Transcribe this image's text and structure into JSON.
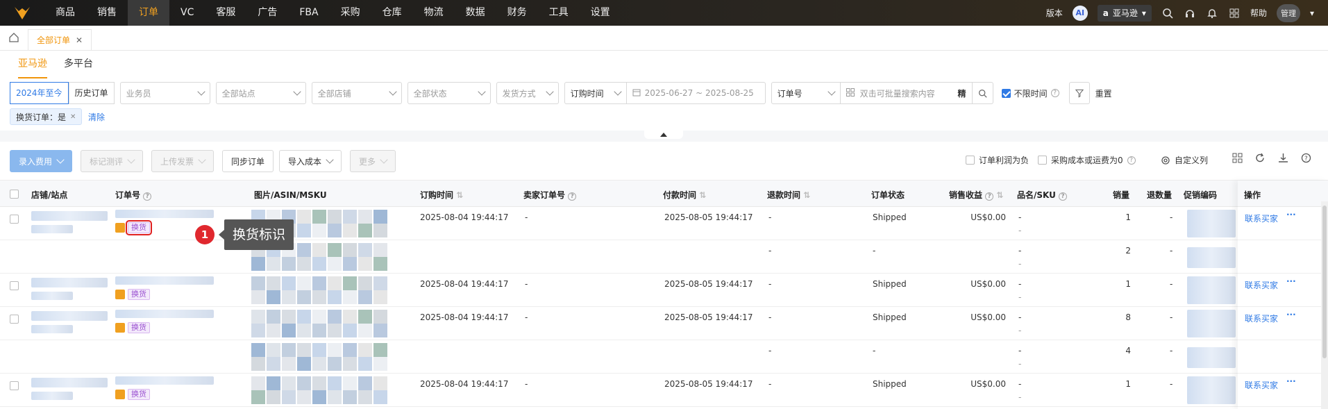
{
  "nav": {
    "items": [
      "商品",
      "销售",
      "订单",
      "VC",
      "客服",
      "广告",
      "FBA",
      "采购",
      "仓库",
      "物流",
      "数据",
      "财务",
      "工具",
      "设置"
    ],
    "active": "订单",
    "version_label": "版本",
    "ai_label": "AI",
    "marketplace": "亚马逊",
    "help_label": "帮助",
    "user_label": "管理"
  },
  "tabs": {
    "page_tab": "全部订单"
  },
  "sub_tabs": [
    "亚马逊",
    "多平台"
  ],
  "filters": {
    "period_seg": [
      "2024年至今",
      "历史订单"
    ],
    "salesperson": "业务员",
    "site": "全部站点",
    "store": "全部店铺",
    "status": "全部状态",
    "ship_method": "发货方式",
    "time_type": "订购时间",
    "date_range": "2025-06-27 ~ 2025-08-25",
    "search_field": "订单号",
    "search_placeholder": "双击可批量搜索内容",
    "precise_label": "精",
    "unlimited_time_label": "不限时间",
    "reset_label": "重置",
    "active_chip": "换货订单：是",
    "clear_label": "清除"
  },
  "toolbar": {
    "enter_fee": "录入费用",
    "mark_review": "标记测评",
    "upload_invoice": "上传发票",
    "sync_orders": "同步订单",
    "import_cost": "导入成本",
    "more": "更多",
    "negative_profit": "订单利润为负",
    "zero_cost": "采购成本或运费为0",
    "custom_columns": "自定义列"
  },
  "table": {
    "headers": [
      "店铺/站点",
      "订单号",
      "图片/ASIN/MSKU",
      "订购时间",
      "卖家订单号",
      "付款时间",
      "退款时间",
      "订单状态",
      "销售收益",
      "品名/SKU",
      "销量",
      "退数量",
      "促销编码",
      "操作"
    ],
    "exchange_tag": "换货",
    "contact_buyer": "联系买家",
    "more_ops": "···",
    "rows": [
      {
        "order_time": "2025-08-04 19:44:17",
        "seller_order": "-",
        "pay_time": "2025-08-05 19:44:17",
        "refund_time": "-",
        "status": "Shipped",
        "revenue": "US$0.00",
        "sku": "-",
        "sku2": "-",
        "qty": "1",
        "refund_qty": "-",
        "primary": true
      },
      {
        "order_time": "",
        "seller_order": "",
        "pay_time": "",
        "refund_time": "-",
        "status": "-",
        "revenue": "",
        "sku": "-",
        "sku2": "-",
        "qty": "2",
        "refund_qty": "-",
        "primary": false
      },
      {
        "order_time": "2025-08-04 19:44:17",
        "seller_order": "-",
        "pay_time": "2025-08-05 19:44:17",
        "refund_time": "-",
        "status": "Shipped",
        "revenue": "US$0.00",
        "sku": "-",
        "sku2": "-",
        "qty": "1",
        "refund_qty": "-",
        "primary": true
      },
      {
        "order_time": "2025-08-04 19:44:17",
        "seller_order": "-",
        "pay_time": "2025-08-05 19:44:17",
        "refund_time": "-",
        "status": "Shipped",
        "revenue": "US$0.00",
        "sku": "-",
        "sku2": "-",
        "qty": "8",
        "refund_qty": "-",
        "primary": true
      },
      {
        "order_time": "",
        "seller_order": "",
        "pay_time": "",
        "refund_time": "-",
        "status": "-",
        "revenue": "",
        "sku": "-",
        "sku2": "-",
        "qty": "4",
        "refund_qty": "-",
        "primary": false
      },
      {
        "order_time": "2025-08-04 19:44:17",
        "seller_order": "-",
        "pay_time": "2025-08-05 19:44:17",
        "refund_time": "-",
        "status": "Shipped",
        "revenue": "US$0.00",
        "sku": "-",
        "sku2": "-",
        "qty": "1",
        "refund_qty": "-",
        "primary": true
      }
    ]
  },
  "callout": {
    "number": "1",
    "text": "换货标识"
  },
  "colors": {
    "accent": "#f0940a",
    "link": "#2f7ae5",
    "exchange_tag": "#9a50d0",
    "callout": "#e0282e"
  }
}
